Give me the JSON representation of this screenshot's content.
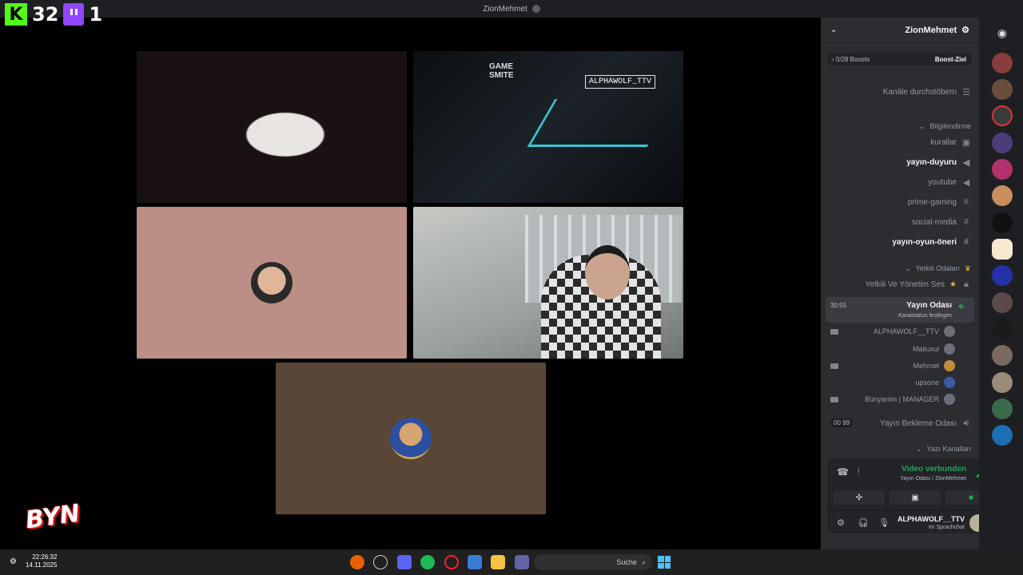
{
  "window": {
    "title": "ZionMehmet"
  },
  "overlay": {
    "kick_count": "32",
    "twitch_count": "1",
    "kick_icon": "kick-icon",
    "twitch_icon": "twitch-icon"
  },
  "stage": {
    "cam2_sign": "ALPHAWOLF_TTV",
    "cam2_game": "GAME",
    "cam2_game_sub": "SMITE",
    "watermark": "BYN"
  },
  "server": {
    "name": "ZionMehmet",
    "boost_label": "Boost-Ziel",
    "boost_count": "0/28 Boosts",
    "browse": "Kanäle durchstöbern"
  },
  "channels": [
    {
      "label": "Bilgilendirme",
      "kind": "category"
    },
    {
      "label": "kurallar",
      "kind": "text"
    },
    {
      "label": "yayın-duyuru",
      "kind": "announce",
      "bold": true
    },
    {
      "label": "youtube",
      "kind": "announce"
    },
    {
      "label": "prime-gaming",
      "kind": "text"
    },
    {
      "label": "social-media",
      "kind": "text"
    },
    {
      "label": "yayın-oyun-öneri",
      "kind": "text",
      "bold": true
    },
    {
      "label": "Yetkili Odaları",
      "kind": "category"
    },
    {
      "label": "Yetkili Ve Yönetim Ses",
      "kind": "locked"
    }
  ],
  "voice_active": {
    "name": "Yayın Odası",
    "status": "Kanalstatus festlegen",
    "time": "30:55"
  },
  "voice_users": [
    {
      "name": "ALPHAWOLF__TTV",
      "cam": true
    },
    {
      "name": "Maliuxul",
      "cam": false
    },
    {
      "name": "Mehmet",
      "cam": true
    },
    {
      "name": "upsone",
      "cam": false
    },
    {
      "name": "Bünyamin | MANAGER",
      "cam": true
    }
  ],
  "waiting": {
    "name": "Yayın Bekleme Odası",
    "badge": "00  99"
  },
  "text_category": "Yazı Kanalları",
  "rtc": {
    "status": "Video verbunden",
    "channel": "Yayın Odası / ZionMehmet"
  },
  "user_panel": {
    "name": "ALPHAWOLF__TTV",
    "status": "Im Sprachchat"
  },
  "taskbar": {
    "time": "22:26:32",
    "date": "14.11.2025",
    "search_placeholder": "Suche"
  },
  "colors": {
    "accent_green": "#23a55a",
    "sidebar": "#2b2d31",
    "guilds": "#1e1f22",
    "tile_pink": "#bb8f86",
    "tile_brown": "#5a4636"
  }
}
